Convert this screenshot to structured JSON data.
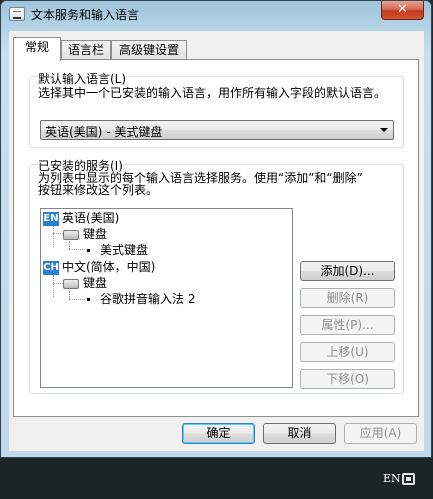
{
  "window": {
    "title": "文本服务和输入语言",
    "close_label": "✕"
  },
  "tabs": [
    {
      "label": "常规"
    },
    {
      "label": "语言栏"
    },
    {
      "label": "高级键设置"
    }
  ],
  "default_language": {
    "group_label": "默认输入语言(L)",
    "description": "选择其中一个已安装的输入语言，用作所有输入字段的默认语言。",
    "selected_value": "英语(美国) - 美式键盘"
  },
  "installed_services": {
    "group_label": "已安装的服务(I)",
    "description_line1": "为列表中显示的每个输入语言选择服务。使用“添加”和“删除”",
    "description_line2": "按钮来修改这个列表。",
    "tree": {
      "lang1": {
        "badge": "EN",
        "label": "英语(美国)"
      },
      "lang1_category": "键盘",
      "lang1_item": "美式键盘",
      "lang2": {
        "badge": "CH",
        "label": "中文(简体，中国)"
      },
      "lang2_category": "键盘",
      "lang2_item": "谷歌拼音输入法 2"
    },
    "buttons": {
      "add": "添加(D)...",
      "remove": "删除(R)",
      "properties": "属性(P)...",
      "move_up": "上移(U)",
      "move_down": "下移(O)"
    }
  },
  "footer": {
    "ok": "确定",
    "cancel": "取消",
    "apply": "应用(A)"
  },
  "taskbar": {
    "input_indicator": "EN"
  }
}
